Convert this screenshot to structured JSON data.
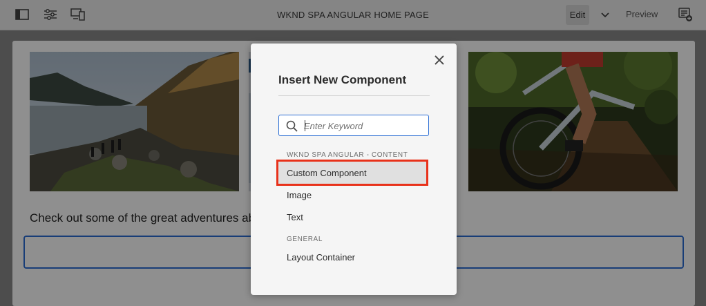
{
  "toolbar": {
    "page_title": "WKND SPA ANGULAR HOME PAGE",
    "edit_label": "Edit",
    "preview_label": "Preview",
    "icons": [
      "side-panel-icon",
      "page-properties-icon",
      "emulator-icon",
      "chevron-down-icon",
      "annotations-icon"
    ]
  },
  "page": {
    "blurb": "Check out some of the great adventures ab"
  },
  "dialog": {
    "title": "Insert New Component",
    "search_placeholder": "Enter Keyword",
    "groups": [
      {
        "heading": "WKND SPA ANGULAR - CONTENT",
        "items": [
          "Custom Component",
          "Image",
          "Text"
        ]
      },
      {
        "heading": "GENERAL",
        "items": [
          "Layout Container"
        ]
      }
    ],
    "selected_item": "Custom Component"
  },
  "colors": {
    "accent_blue": "#2c6ed4",
    "highlight_red": "#e8311a"
  }
}
